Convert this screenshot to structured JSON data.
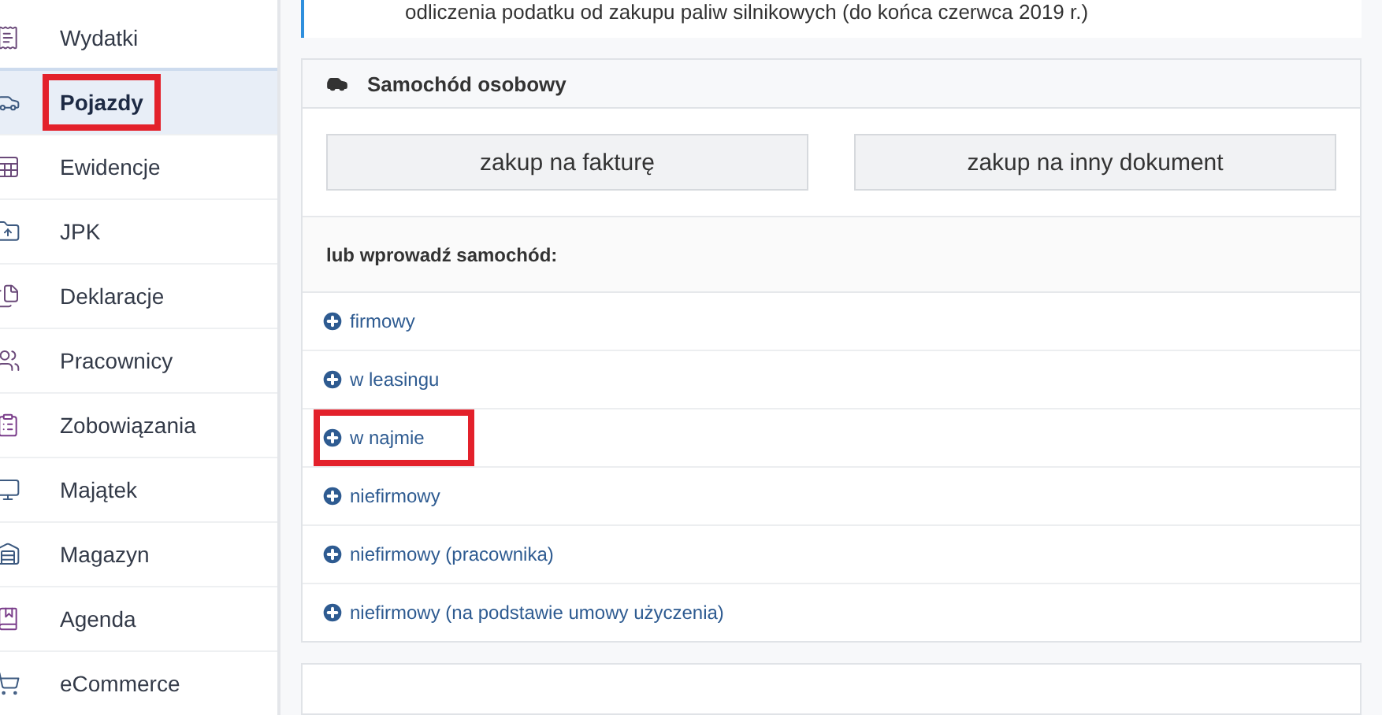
{
  "sidebar": {
    "items": [
      {
        "label": "Wydatki",
        "kind": "receipt",
        "selected": false,
        "highlighted": false
      },
      {
        "label": "Pojazdy",
        "kind": "car",
        "selected": true,
        "highlighted": true
      },
      {
        "label": "Ewidencje",
        "kind": "sheet",
        "selected": false,
        "highlighted": false
      },
      {
        "label": "JPK",
        "kind": "folder",
        "selected": false,
        "highlighted": false
      },
      {
        "label": "Deklaracje",
        "kind": "files",
        "selected": false,
        "highlighted": false
      },
      {
        "label": "Pracownicy",
        "kind": "users",
        "selected": false,
        "highlighted": false
      },
      {
        "label": "Zobowiązania",
        "kind": "clipboard",
        "selected": false,
        "highlighted": false
      },
      {
        "label": "Majątek",
        "kind": "monitor",
        "selected": false,
        "highlighted": false
      },
      {
        "label": "Magazyn",
        "kind": "warehouse",
        "selected": false,
        "highlighted": false
      },
      {
        "label": "Agenda",
        "kind": "book",
        "selected": false,
        "highlighted": false
      },
      {
        "label": "eCommerce",
        "kind": "cart",
        "selected": false,
        "highlighted": false
      }
    ]
  },
  "notice": {
    "text": "odliczenia podatku od zakupu paliw silnikowych (do końca czerwca 2019 r.)"
  },
  "card": {
    "title": "Samochód osobowy",
    "buttons": [
      "zakup na fakturę",
      "zakup na inny dokument"
    ],
    "prompt": "lub wprowadź samochód:",
    "options": [
      {
        "label": "firmowy",
        "highlighted": false
      },
      {
        "label": "w leasingu",
        "highlighted": false
      },
      {
        "label": "w najmie",
        "highlighted": true
      },
      {
        "label": "niefirmowy",
        "highlighted": false
      },
      {
        "label": "niefirmowy (pracownika)",
        "highlighted": false
      },
      {
        "label": "niefirmowy (na podstawie umowy użyczenia)",
        "highlighted": false
      }
    ]
  }
}
